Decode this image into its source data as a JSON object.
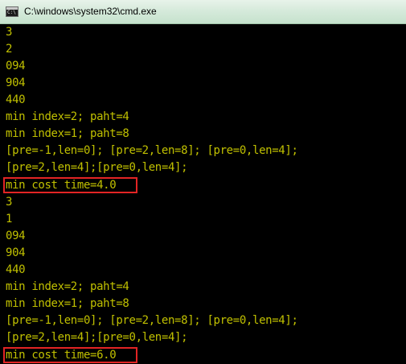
{
  "window": {
    "title": "C:\\windows\\system32\\cmd.exe",
    "icon": "cmd-console-icon"
  },
  "console": {
    "text_color": "#c0c000",
    "background": "#000000",
    "highlight_color": "#e22424",
    "lines": [
      "3",
      "2",
      "094",
      "904",
      "440",
      "min index=2; paht=4",
      "min index=1; paht=8",
      "[pre=-1,len=0]; [pre=2,len=8]; [pre=0,len=4];",
      "[pre=2,len=4];[pre=0,len=4];",
      "min cost time=4.0",
      "3",
      "1",
      "094",
      "904",
      "440",
      "min index=2; paht=4",
      "min index=1; paht=8",
      "[pre=-1,len=0]; [pre=2,len=8]; [pre=0,len=4];",
      "[pre=2,len=4];[pre=0,len=4];",
      "min cost time=6.0"
    ]
  }
}
